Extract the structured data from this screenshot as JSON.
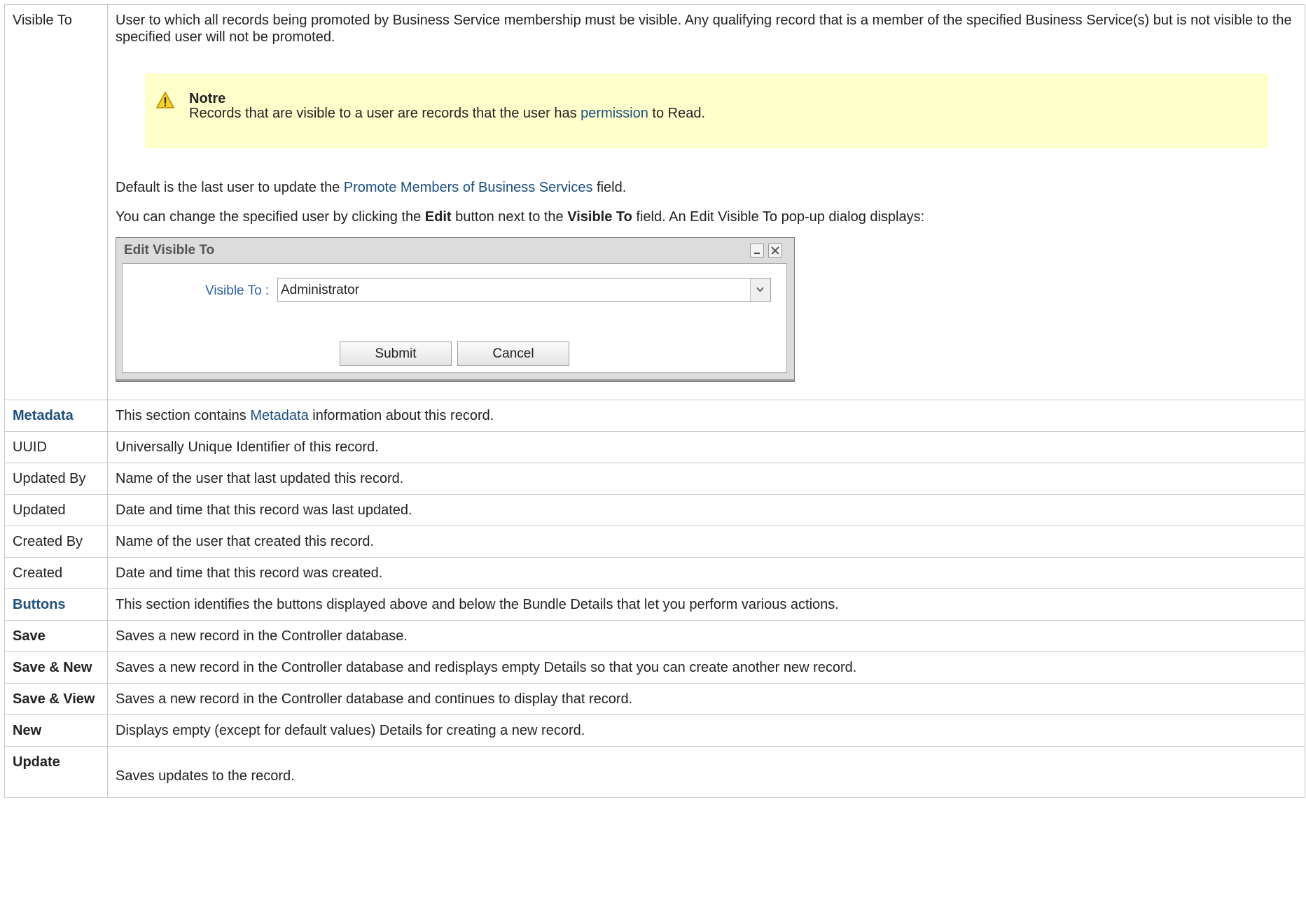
{
  "visible_to": {
    "label": "Visible To",
    "description": "User to which all records being promoted by Business Service membership must be visible. Any qualifying record that is a member of the specified Business Service(s) but is not visible to the specified user will not be promoted.",
    "note": {
      "title": "Notre",
      "text_before": "Records that are visible to a user are records that the user has ",
      "link": "permission",
      "text_after": " to Read."
    },
    "default": {
      "before": "Default is the last user to update the ",
      "link": "Promote Members of Business Services",
      "after": " field."
    },
    "change": {
      "t1": "You can change the specified user by clicking the ",
      "b1": "Edit",
      "t2": " button next to the ",
      "b2": "Visible To",
      "t3": " field. An Edit Visible To pop-up dialog displays:"
    },
    "dialog": {
      "title": "Edit Visible To",
      "field_label": "Visible To :",
      "field_value": "Administrator",
      "submit_label": "Submit",
      "cancel_label": "Cancel"
    }
  },
  "metadata": {
    "label": "Metadata",
    "before": "This section contains ",
    "link": "Metadata",
    "after": " information about this record."
  },
  "metadata_rows": [
    {
      "label": "UUID",
      "desc": "Universally Unique Identifier of this record."
    },
    {
      "label": "Updated By",
      "desc": "Name of the user that last updated this record."
    },
    {
      "label": "Updated",
      "desc": "Date and time that this record was last updated."
    },
    {
      "label": "Created By",
      "desc": "Name of the user that created this record."
    },
    {
      "label": "Created",
      "desc": "Date and time that this record was created."
    }
  ],
  "buttons": {
    "label": "Buttons",
    "desc": "This section identifies the buttons displayed above and below the Bundle Details that let you perform various actions."
  },
  "button_rows": [
    {
      "label": "Save",
      "desc": "Saves a new record in the Controller database."
    },
    {
      "label": "Save & New",
      "desc": "Saves a new record in the Controller database and redisplays empty Details so that you can create another new record."
    },
    {
      "label": "Save & View",
      "desc": "Saves a new record in the Controller database and continues to display that record."
    },
    {
      "label": "New",
      "desc": "Displays empty (except for default values) Details for creating a new record."
    },
    {
      "label": "Update",
      "desc": "Saves updates to the record."
    }
  ]
}
